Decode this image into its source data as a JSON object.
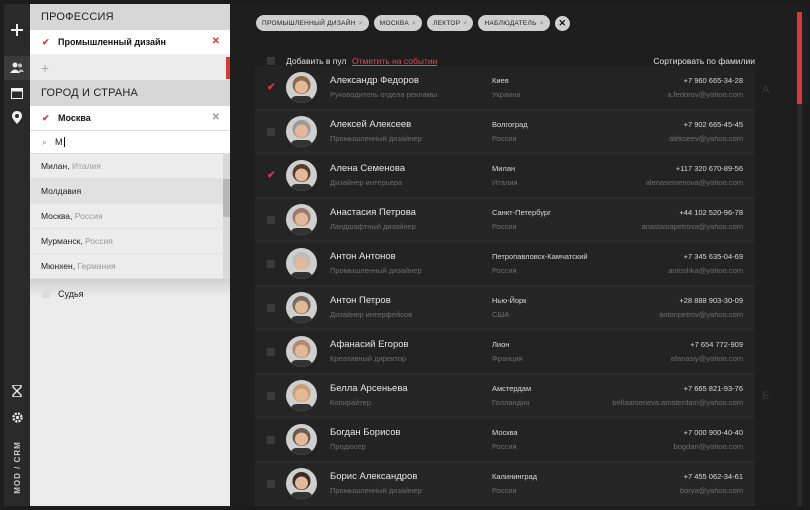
{
  "app": {
    "brand": "MOD / CRM"
  },
  "rail": {
    "icons": [
      "plus-icon",
      "contacts-icon",
      "calendar-icon",
      "location-pin-icon",
      "hourglass-icon",
      "gear-icon"
    ]
  },
  "filters": {
    "profession": {
      "title": "ПРОФЕССИЯ",
      "selected": "Промышленный дизайн"
    },
    "city": {
      "title": "ГОРОД И СТРАНА",
      "selected": "Москва",
      "search_value": "М"
    },
    "suggestions": [
      {
        "city": "Милан",
        "country": "Италия"
      },
      {
        "city": "Молдавия",
        "country": ""
      },
      {
        "city": "Москва",
        "country": "Россия"
      },
      {
        "city": "Мурманск",
        "country": "Россия"
      },
      {
        "city": "Мюнхен",
        "country": "Германия"
      }
    ],
    "extra_option": "Судья"
  },
  "tags": [
    {
      "label": "ПРОМЫШЛЕННЫЙ ДИЗАЙН"
    },
    {
      "label": "МОСКВА"
    },
    {
      "label": "ЛЕКТОР"
    },
    {
      "label": "НАБЛЮДАТЕЛЬ"
    }
  ],
  "toolbar": {
    "add_to_pool": "Добавить в пул",
    "mark_on_event": "Отметить на событии",
    "sort_label": "Сортировать по фамилии"
  },
  "index_letters": [
    "А",
    "Б"
  ],
  "contacts": [
    {
      "name": "Александр Федоров",
      "position": "Руководитель отдела рекламы",
      "city": "Киев",
      "country": "Украина",
      "phone": "+7 960 665-34-28",
      "email": "a.fedorov@yahoo.com",
      "checked": true,
      "avatar_color": "#8a6a4a"
    },
    {
      "name": "Алексей Алексеев",
      "position": "Промышленный дизайнер",
      "city": "Волгоград",
      "country": "Россия",
      "phone": "+7 902 665-45-45",
      "email": "alekseev@yahoo.com",
      "checked": false,
      "avatar_color": "#9a9a9a"
    },
    {
      "name": "Алена Семенова",
      "position": "Дизайнер интерьера",
      "city": "Милан",
      "country": "Италия",
      "phone": "+117 320 670-89-56",
      "email": "alenasemenova@yahoo.com",
      "checked": true,
      "avatar_color": "#5a3a2a"
    },
    {
      "name": "Анастасия Петрова",
      "position": "Ландшафтный дизайнер",
      "city": "Санкт-Петербург",
      "country": "Россия",
      "phone": "+44 102 520-96-78",
      "email": "anastasiapetrova@yahoo.com",
      "checked": false,
      "avatar_color": "#a0786a"
    },
    {
      "name": "Антон Антонов",
      "position": "Промышленный дизайнер",
      "city": "Петропавловск-Камчатский",
      "country": "Россия",
      "phone": "+7 345 635-04-69",
      "email": "antoshka@yahoo.com",
      "checked": false,
      "avatar_color": "#bdbdbd"
    },
    {
      "name": "Антон Петров",
      "position": "Дизайнер интерфейсов",
      "city": "Нью-Йорк",
      "country": "США",
      "phone": "+28 888 903-30-09",
      "email": "antonpetrov@yahoo.com",
      "checked": false,
      "avatar_color": "#7a6a5a"
    },
    {
      "name": "Афанасий Егоров",
      "position": "Креативный директор",
      "city": "Лион",
      "country": "Франция",
      "phone": "+7 654 772-909",
      "email": "afanasiy@yahoo.com",
      "checked": false,
      "avatar_color": "#b08a6a"
    },
    {
      "name": "Белла Арсеньева",
      "position": "Копирайтер",
      "city": "Амстердам",
      "country": "Голландия",
      "phone": "+7 665 821-93-76",
      "email": "bellaarseneva.amsterdam@yahoo.com",
      "checked": false,
      "avatar_color": "#c8a070"
    },
    {
      "name": "Богдан Борисов",
      "position": "Продюсер",
      "city": "Москва",
      "country": "Россия",
      "phone": "+7 000 900-40-40",
      "email": "bogdan@yahoo.com",
      "checked": false,
      "avatar_color": "#6a5a4a"
    },
    {
      "name": "Борис Александров",
      "position": "Промышленный дизайнер",
      "city": "Калининград",
      "country": "Россия",
      "phone": "+7 455 062-34-61",
      "email": "borya@yahoo.com",
      "checked": false,
      "avatar_color": "#3a2a22"
    }
  ]
}
